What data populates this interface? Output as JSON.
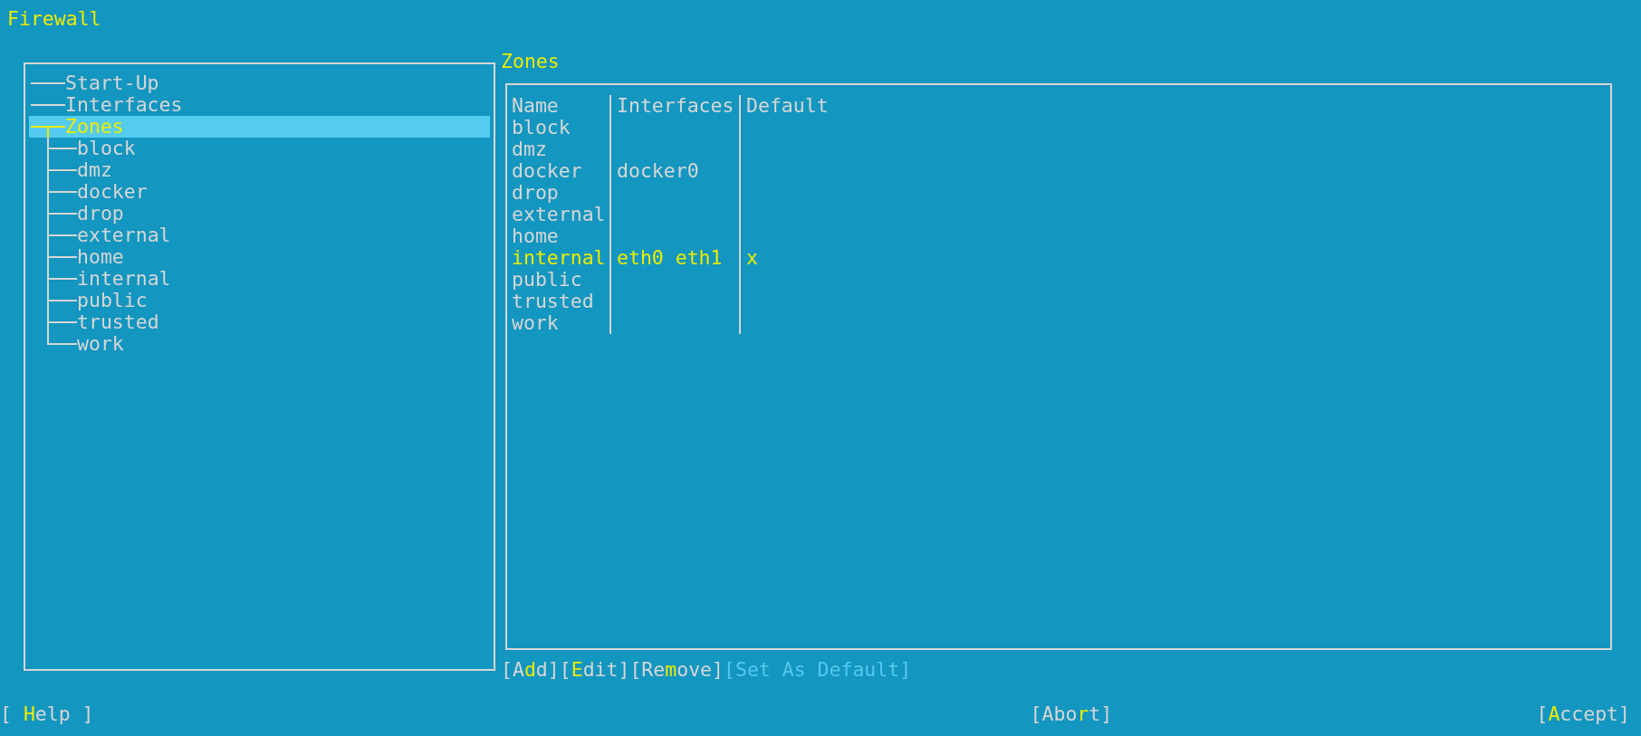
{
  "window": {
    "title": "Firewall"
  },
  "tree": [
    {
      "label": "Start-Up",
      "selected": false
    },
    {
      "label": "Interfaces",
      "selected": false
    },
    {
      "label": "Zones",
      "selected": true,
      "expanded": true,
      "children": [
        {
          "label": "block",
          "selected": false
        },
        {
          "label": "dmz",
          "selected": false
        },
        {
          "label": "docker",
          "selected": false
        },
        {
          "label": "drop",
          "selected": false
        },
        {
          "label": "external",
          "selected": false
        },
        {
          "label": "home",
          "selected": false
        },
        {
          "label": "internal",
          "selected": false
        },
        {
          "label": "public",
          "selected": false
        },
        {
          "label": "trusted",
          "selected": false
        },
        {
          "label": "work",
          "selected": false
        }
      ]
    }
  ],
  "zones_panel": {
    "title": "Zones",
    "table": {
      "columns": [
        "Name",
        "Interfaces",
        "Default"
      ],
      "rows": [
        {
          "cells": [
            "block",
            "",
            ""
          ],
          "selected": false
        },
        {
          "cells": [
            "dmz",
            "",
            ""
          ],
          "selected": false
        },
        {
          "cells": [
            "docker",
            "docker0",
            ""
          ],
          "selected": false
        },
        {
          "cells": [
            "drop",
            "",
            ""
          ],
          "selected": false
        },
        {
          "cells": [
            "external",
            "",
            ""
          ],
          "selected": false
        },
        {
          "cells": [
            "home",
            "",
            ""
          ],
          "selected": false
        },
        {
          "cells": [
            "internal",
            "eth0 eth1",
            "x"
          ],
          "selected": true
        },
        {
          "cells": [
            "public",
            "",
            ""
          ],
          "selected": false
        },
        {
          "cells": [
            "trusted",
            "",
            ""
          ],
          "selected": false
        },
        {
          "cells": [
            "work",
            "",
            ""
          ],
          "selected": false
        }
      ]
    },
    "buttons": [
      {
        "pre": "[A",
        "key": "d",
        "post": "d]",
        "disabled": false
      },
      {
        "pre": "[",
        "key": "E",
        "post": "dit]",
        "disabled": false
      },
      {
        "pre": "[Re",
        "key": "m",
        "post": "ove]",
        "disabled": false
      },
      {
        "pre": "[Set As Default]",
        "disabled": true
      }
    ]
  },
  "footer": {
    "help": {
      "pre": "[ ",
      "key": "H",
      "post": "elp ]"
    },
    "abort": {
      "pre": "[Abo",
      "key": "r",
      "post": "t]"
    },
    "accept": {
      "pre": "[",
      "key": "A",
      "post": "ccept]"
    }
  }
}
